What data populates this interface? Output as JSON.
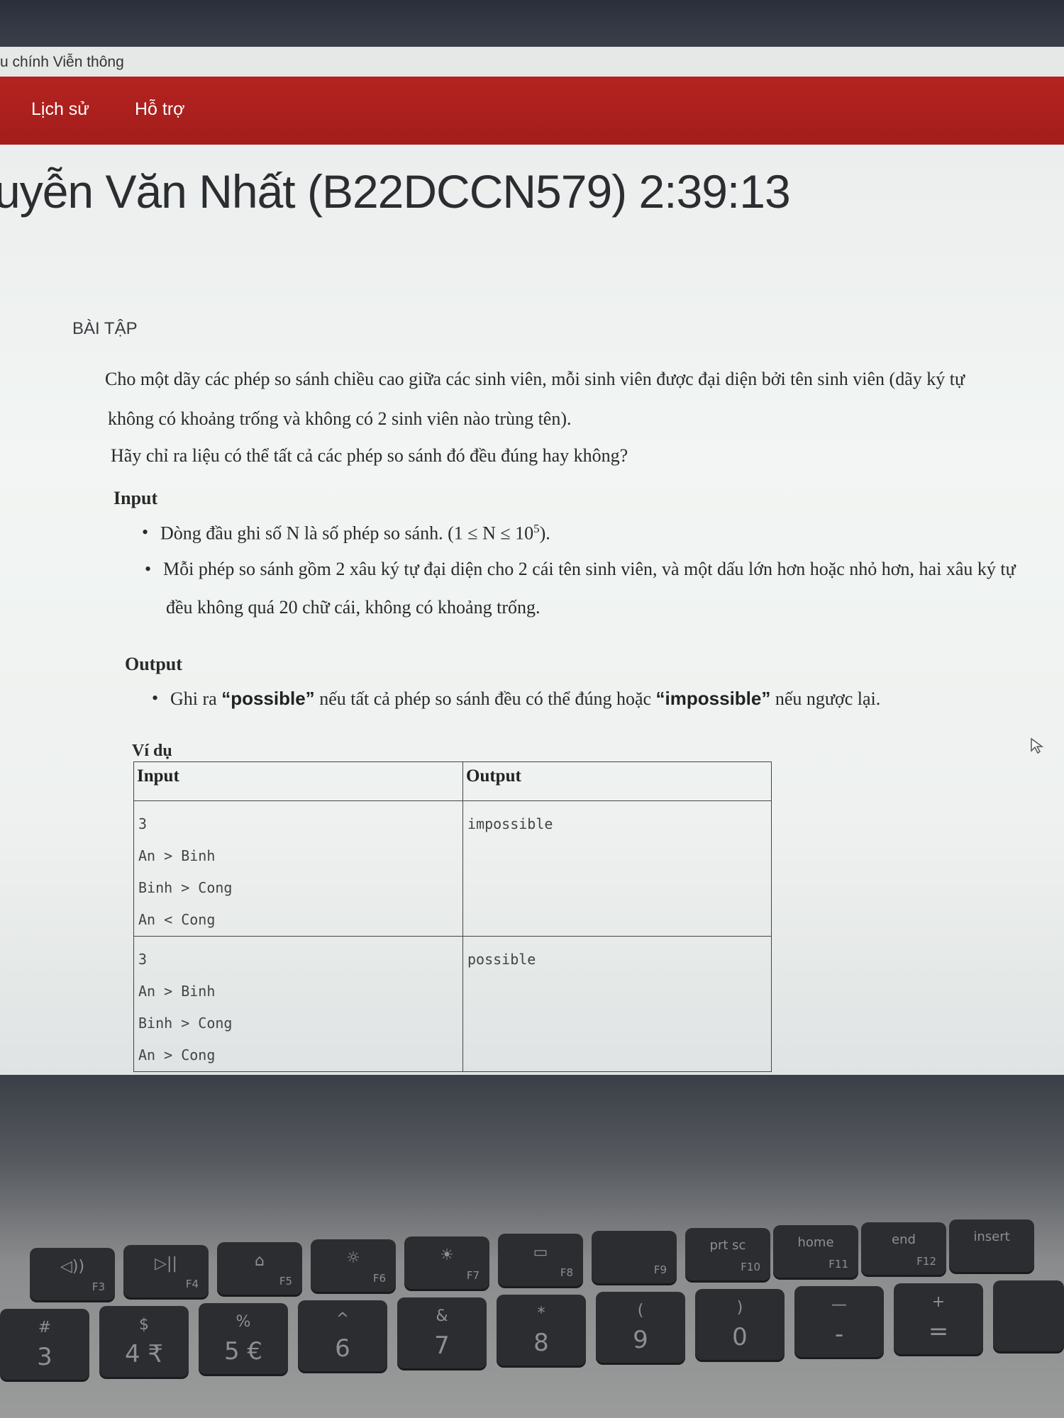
{
  "site": {
    "name": "u chính Viễn thông"
  },
  "nav": {
    "items": [
      "Lịch sử",
      "Hỗ trợ"
    ]
  },
  "header": {
    "title": "uyễn Văn Nhất (B22DCCN579) 2:39:13"
  },
  "section": {
    "label": "BÀI TẬP"
  },
  "problem": {
    "para1_line1": "Cho một dãy các phép so sánh chiều cao giữa các sinh viên, mỗi sinh viên được đại diện bởi tên sinh viên (dãy ký tự",
    "para1_line2": "không có khoảng trống và không có 2 sinh viên nào trùng tên).",
    "para2": "Hãy chỉ ra liệu có thể tất cả các phép so sánh đó đều đúng hay không?",
    "input_heading": "Input",
    "input_bullet1_text": "Dòng đầu ghi số N là số phép so sánh. ",
    "input_bullet1_math": "(1 ≤ N ≤ 10",
    "input_bullet1_exp": "5",
    "input_bullet1_end": ").",
    "input_bullet2_line1": "Mỗi phép so sánh gồm 2 xâu ký tự đại diện cho 2 cái tên sinh viên, và một dấu lớn hơn hoặc nhỏ hơn, hai xâu ký tự",
    "input_bullet2_line2": "đều không quá 20 chữ cái, không có khoảng trống.",
    "output_heading": "Output",
    "output_pre": "Ghi ra ",
    "output_kw1": "“possible”",
    "output_mid": " nếu tất cả phép so sánh đều có thể đúng hoặc ",
    "output_kw2": "“impossible”",
    "output_post": " nếu ngược lại.",
    "example_heading": "Ví dụ"
  },
  "examples": {
    "col_input": "Input",
    "col_output": "Output",
    "rows": [
      {
        "input": [
          "3",
          "An > Binh",
          "Binh > Cong",
          "An < Cong"
        ],
        "output": "impossible"
      },
      {
        "input": [
          "3",
          "An > Binh",
          "Binh > Cong",
          "An > Cong"
        ],
        "output": "possible"
      }
    ]
  },
  "keyboard": {
    "fn_row": [
      {
        "icon": "◁))",
        "fn": "F3"
      },
      {
        "icon": "▷||",
        "fn": "F4"
      },
      {
        "icon": "⌂",
        "fn": "F5"
      },
      {
        "icon": "☼",
        "fn": "F6"
      },
      {
        "icon": "☀",
        "fn": "F7"
      },
      {
        "icon": "▭",
        "fn": "F8"
      },
      {
        "icon": "",
        "fn": "F9"
      },
      {
        "icon": "prt sc",
        "fn": "F10"
      },
      {
        "icon": "home",
        "fn": "F11"
      },
      {
        "icon": "end",
        "fn": "F12"
      },
      {
        "icon": "insert",
        "fn": ""
      }
    ],
    "num_row": [
      {
        "shift": "#",
        "main": "3"
      },
      {
        "shift": "$",
        "main": "4 ₹"
      },
      {
        "shift": "%",
        "main": "5 €"
      },
      {
        "shift": "^",
        "main": "6"
      },
      {
        "shift": "&",
        "main": "7"
      },
      {
        "shift": "*",
        "main": "8"
      },
      {
        "shift": "(",
        "main": "9"
      },
      {
        "shift": ")",
        "main": "0"
      },
      {
        "shift": "—",
        "main": "-"
      },
      {
        "shift": "+",
        "main": "="
      }
    ]
  }
}
